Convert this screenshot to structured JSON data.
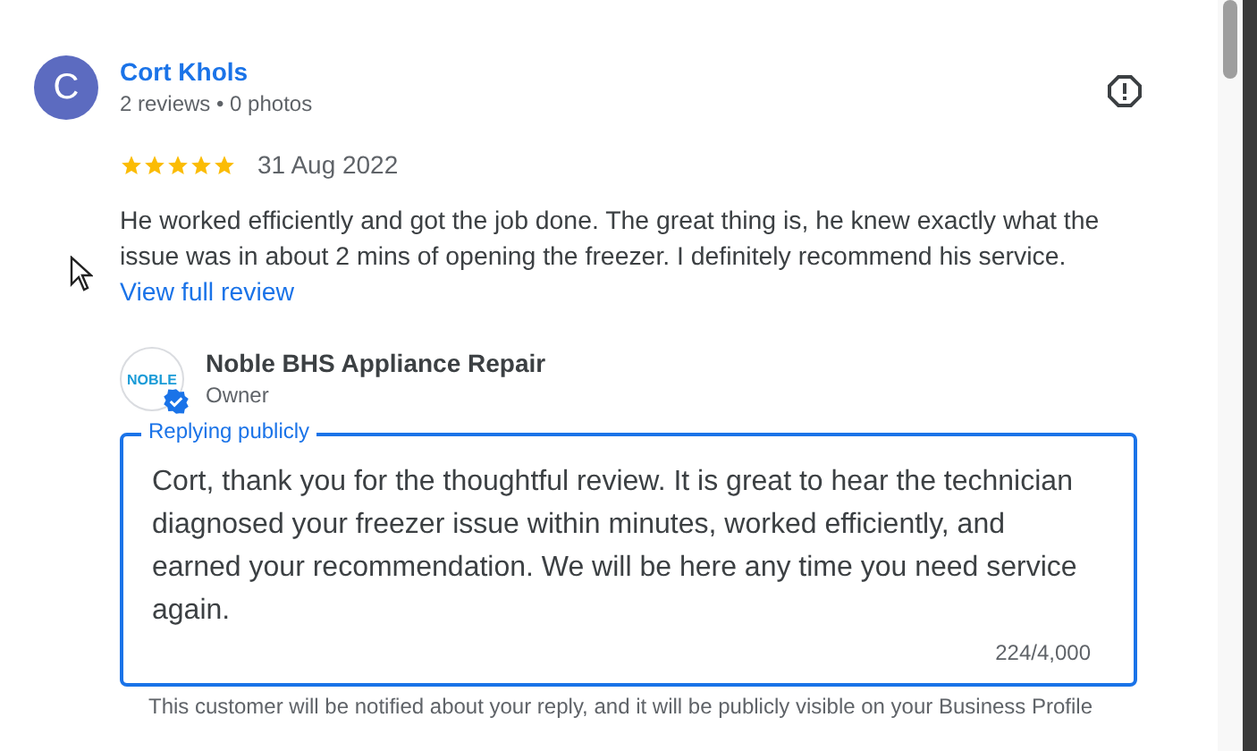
{
  "review": {
    "avatar_letter": "C",
    "author": "Cort Khols",
    "meta": "2 reviews • 0 photos",
    "stars": 5,
    "date": "31 Aug 2022",
    "text": "He worked efficiently and got the job done. The great thing is, he knew exactly what the issue was in about 2 mins of opening the freezer. I definitely recommend his service.",
    "more_link": "View full review"
  },
  "owner": {
    "logo_text": "NOBLE",
    "verified": true,
    "name": "Noble BHS Appliance Repair",
    "role": "Owner"
  },
  "reply": {
    "label": "Replying publicly",
    "value": "Cort, thank you for the thoughtful review. It is great to hear the technician diagnosed your freezer issue within minutes, worked efficiently, and earned your recommendation. We will be here any time you need service again.",
    "counter": "224/4,000",
    "hint": "This customer will be notified about your reply, and it will be publicly visible on your Business Profile"
  }
}
